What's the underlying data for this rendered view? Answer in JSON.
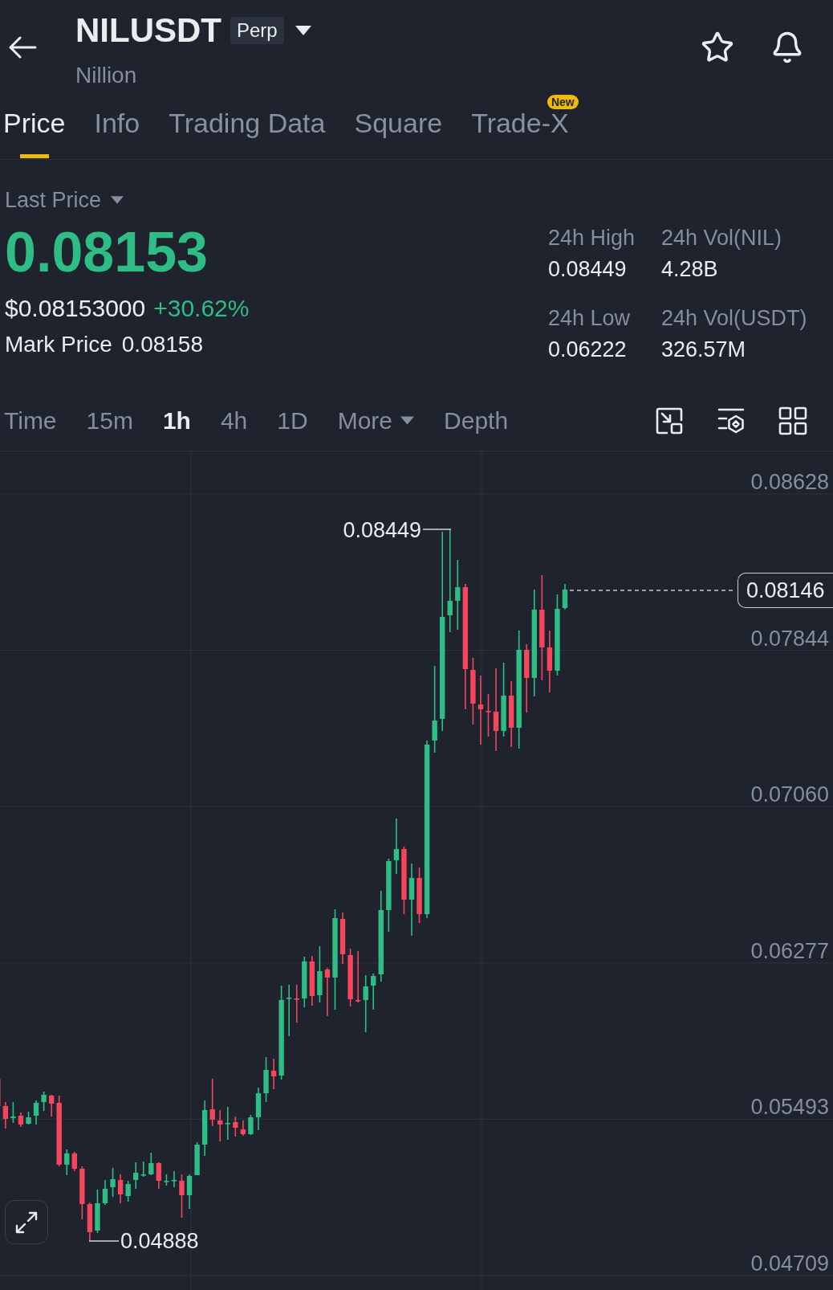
{
  "header": {
    "symbol": "NILUSDT",
    "contract_type": "Perp",
    "name": "Nillion"
  },
  "tabs": [
    {
      "label": "Price",
      "selected": true
    },
    {
      "label": "Info",
      "selected": false
    },
    {
      "label": "Trading Data",
      "selected": false
    },
    {
      "label": "Square",
      "selected": false
    },
    {
      "label": "Trade-X",
      "selected": false,
      "badge": "New"
    }
  ],
  "price": {
    "price_type": "Last Price",
    "last_price": "0.08153",
    "usd_value": "$0.08153000",
    "change": "+30.62%",
    "mark_price_label": "Mark Price",
    "mark_price": "0.08158"
  },
  "stats": [
    {
      "label": "24h High",
      "value": "0.08449"
    },
    {
      "label": "24h Vol(NIL)",
      "value": "4.28B"
    },
    {
      "label": "24h Low",
      "value": "0.06222"
    },
    {
      "label": "24h Vol(USDT)",
      "value": "326.57M"
    }
  ],
  "intervals": [
    {
      "label": "Time",
      "kind": "option",
      "selected": false
    },
    {
      "label": "15m",
      "kind": "option",
      "selected": false
    },
    {
      "label": "1h",
      "kind": "option",
      "selected": true
    },
    {
      "label": "4h",
      "kind": "option",
      "selected": false
    },
    {
      "label": "1D",
      "kind": "option",
      "selected": false
    },
    {
      "label": "More",
      "kind": "dropdown",
      "selected": false
    },
    {
      "label": "Depth",
      "kind": "option",
      "selected": false
    }
  ],
  "chart": {
    "y_axis": [
      "0.08628",
      "0.07844",
      "0.07060",
      "0.06277",
      "0.05493",
      "0.04709"
    ],
    "high_label": "0.08449",
    "low_label": "0.04888",
    "current_price": "0.08146"
  }
}
